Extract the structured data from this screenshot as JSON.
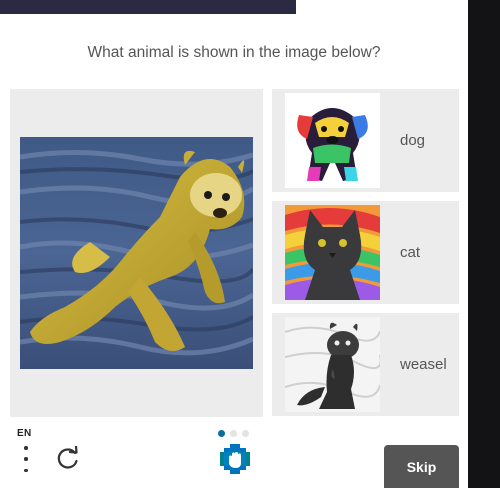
{
  "prompt": "What animal is shown in the image below?",
  "task_image": {
    "icon": "weasel-painting-image"
  },
  "choices": [
    {
      "label": "dog",
      "icon": "dog-image"
    },
    {
      "label": "cat",
      "icon": "cat-image"
    },
    {
      "label": "weasel",
      "icon": "weasel-image"
    }
  ],
  "footer": {
    "language": "EN",
    "pager": {
      "count": 3,
      "active_index": 0
    },
    "skip_label": "Skip"
  },
  "colors": {
    "panel_bg": "#ececec",
    "pager_active": "#0a6f9a",
    "skip_bg": "#555555",
    "backdrop": "#131315"
  }
}
